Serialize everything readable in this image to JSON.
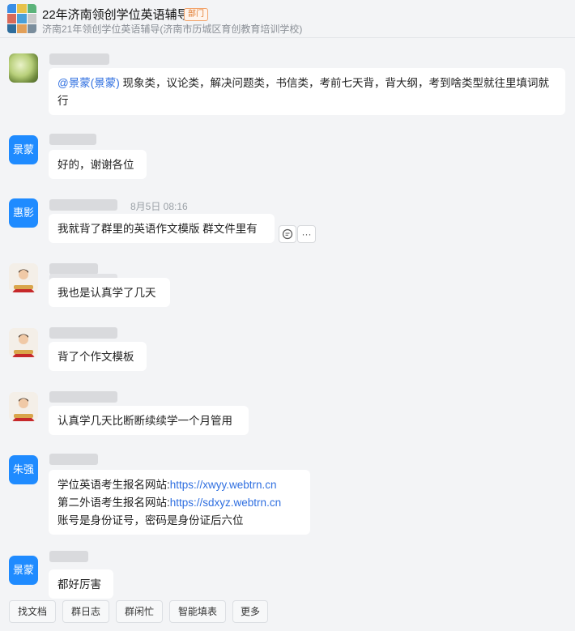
{
  "header": {
    "title": "22年济南领创学位英语辅导",
    "badge": "部门",
    "subtitle": "济南21年领创学位英语辅导(济南市历城区育创教育培训学校)"
  },
  "messages": [
    {
      "avatar_text": "",
      "mention": "@景蒙(景蒙)",
      "text": " 现象类，议论类，解决问题类，书信类，考前七天背，背大纲，考到啥类型就往里填词就行"
    },
    {
      "avatar_text": "景蒙",
      "text": "好的，谢谢各位"
    },
    {
      "avatar_text": "惠影",
      "time": "8月5日 08:16",
      "text": "我就背了群里的英语作文模版 群文件里有"
    },
    {
      "avatar_text": "",
      "text": "我也是认真学了几天"
    },
    {
      "avatar_text": "",
      "text": "背了个作文模板"
    },
    {
      "avatar_text": "",
      "text": "认真学几天比断断续续学一个月管用"
    },
    {
      "avatar_text": "朱强",
      "lines": [
        {
          "label": "学位英语考生报名网站:",
          "link": "https://xwyy.webtrn.cn"
        },
        {
          "label": "第二外语考生报名网站:",
          "link": "https://sdxyz.webtrn.cn"
        },
        {
          "label": "账号是身份证号，密码是身份证后六位",
          "link": ""
        }
      ]
    },
    {
      "avatar_text": "景蒙",
      "text": "都好厉害"
    }
  ],
  "quick_actions": [
    "找文档",
    "群日志",
    "群闲忙",
    "智能填表",
    "更多"
  ],
  "icons": {
    "reply": "chat-bubble-icon",
    "more": "more-dots-icon"
  }
}
